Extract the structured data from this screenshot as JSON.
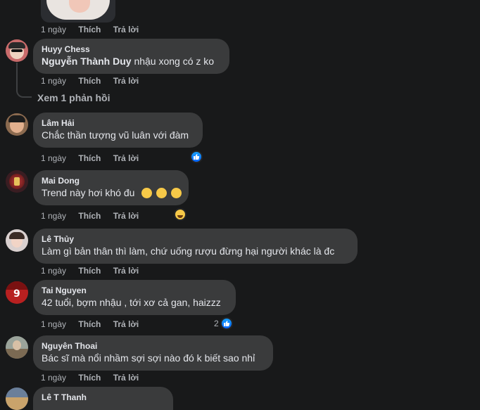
{
  "top": {
    "time": "1 ngày",
    "like": "Thích",
    "reply": "Trả lời"
  },
  "comments": [
    {
      "author": "Huyy Chess",
      "tag": "Nguyễn Thành Duy",
      "text": " nhậu xong có z ko",
      "time": "1 ngày",
      "like": "Thích",
      "reply": "Trả lời",
      "view_replies": "Xem 1 phản hồi"
    },
    {
      "author": "Lâm Hải",
      "text": "Chắc thần tượng vũ luân với đàm",
      "time": "1 ngày",
      "like": "Thích",
      "reply": "Trả lời"
    },
    {
      "author": "Mai Dong",
      "text": "Trend này hơi khó đu",
      "time": "1 ngày",
      "like": "Thích",
      "reply": "Trả lời"
    },
    {
      "author": "Lê Thủy",
      "text": "Làm gì bản thân thì làm, chứ uống rượu đừng hại người khác là đc",
      "time": "1 ngày",
      "like": "Thích",
      "reply": "Trả lời"
    },
    {
      "author": "Tai Nguyen",
      "text": "42 tuổi, bợm nhậu , tới xơ cả gan, haizzz",
      "time": "1 ngày",
      "like": "Thích",
      "reply": "Trả lời",
      "reaction_count": "2"
    },
    {
      "author": "Nguyên Thoai",
      "text": "Bác sĩ mà nổi nhầm sợi sợi nào đó k biết sao nhỉ",
      "time": "1 ngày",
      "like": "Thích",
      "reply": "Trả lời"
    },
    {
      "author": "Lê T Thanh"
    }
  ],
  "icons": {
    "like": "like-reaction-icon",
    "haha": "haha-reaction-icon"
  },
  "colors": {
    "background": "#18191a",
    "bubble": "#3a3b3c",
    "like_blue": "#0866ff",
    "muted": "#b0b3b8"
  }
}
